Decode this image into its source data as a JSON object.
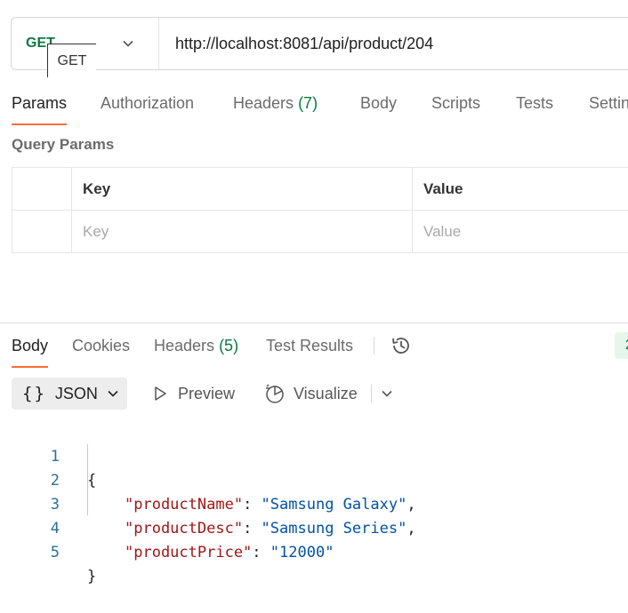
{
  "request": {
    "method": "GET",
    "tooltip": "GET",
    "url": "http://localhost:8081/api/product/204"
  },
  "request_tabs": {
    "params": "Params",
    "authorization": "Authorization",
    "headers": "Headers",
    "headers_count": "(7)",
    "body": "Body",
    "scripts": "Scripts",
    "tests": "Tests",
    "settings": "Settin"
  },
  "query_params": {
    "title": "Query Params",
    "columns": [
      "Key",
      "Value"
    ],
    "placeholders": [
      "Key",
      "Value"
    ]
  },
  "response_tabs": {
    "body": "Body",
    "cookies": "Cookies",
    "headers": "Headers",
    "headers_count": "(5)",
    "test_results": "Test Results",
    "status_partial": "2"
  },
  "body_toolbar": {
    "format_label": "JSON",
    "format_icon": "{}",
    "preview": "Preview",
    "visualize": "Visualize"
  },
  "code": {
    "line_numbers": [
      "1",
      "2",
      "3",
      "4",
      "5"
    ],
    "open_brace": "{",
    "close_brace": "}",
    "entries": [
      {
        "key": "\"productName\"",
        "value": "\"Samsung Galaxy\"",
        "comma": ","
      },
      {
        "key": "\"productDesc\"",
        "value": "\"Samsung Series\"",
        "comma": ","
      },
      {
        "key": "\"productPrice\"",
        "value": "\"12000\"",
        "comma": ""
      }
    ]
  },
  "colors": {
    "method_get": "#0c7a3e",
    "active_tab_underline": "#ff6c37",
    "json_key": "#a31515",
    "json_string": "#0451a5"
  },
  "icons": [
    "chevron-down-icon",
    "history-icon",
    "play-icon",
    "visualize-icon"
  ]
}
